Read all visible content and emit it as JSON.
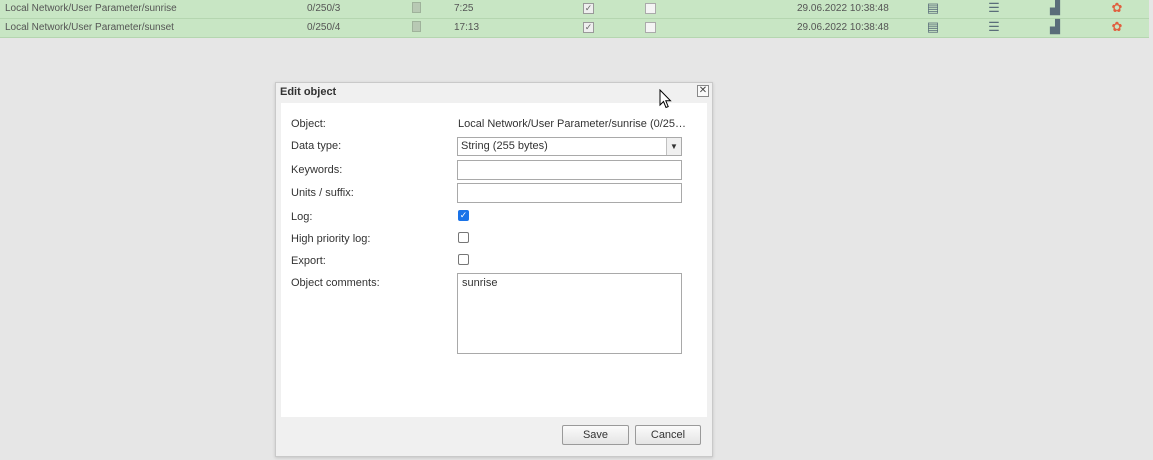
{
  "table": {
    "rows": [
      {
        "name": "Local Network/User Parameter/sunrise",
        "address": "0/250/3",
        "value": "7:25",
        "log_checked": "✓",
        "updated": "29.06.2022 10:38:48"
      },
      {
        "name": "Local Network/User Parameter/sunset",
        "address": "0/250/4",
        "value": "17:13",
        "log_checked": "✓",
        "updated": "29.06.2022 10:38:48"
      }
    ],
    "action_icons": [
      "schedule-icon",
      "settings-sliders-icon",
      "trend-chart-icon",
      "delete-icon"
    ]
  },
  "dialog": {
    "title": "Edit object",
    "close_glyph": "✕",
    "fields": {
      "object_label": "Object:",
      "object_value": "Local Network/User Parameter/sunrise (0/25…",
      "datatype_label": "Data type:",
      "datatype_value": "String (255 bytes)",
      "keywords_label": "Keywords:",
      "keywords_value": "",
      "units_label": "Units / suffix:",
      "units_value": "",
      "log_label": "Log:",
      "log_checked": true,
      "high_priority_label": "High priority log:",
      "high_priority_checked": false,
      "export_label": "Export:",
      "export_checked": false,
      "comments_label": "Object comments:",
      "comments_value": "sunrise"
    },
    "buttons": {
      "save": "Save",
      "cancel": "Cancel"
    }
  },
  "colors": {
    "row_bg": "#c8e6c4",
    "page_bg": "#e6e6e6",
    "checkbox_accent": "#1a73e8",
    "delete_icon": "#e06040"
  }
}
